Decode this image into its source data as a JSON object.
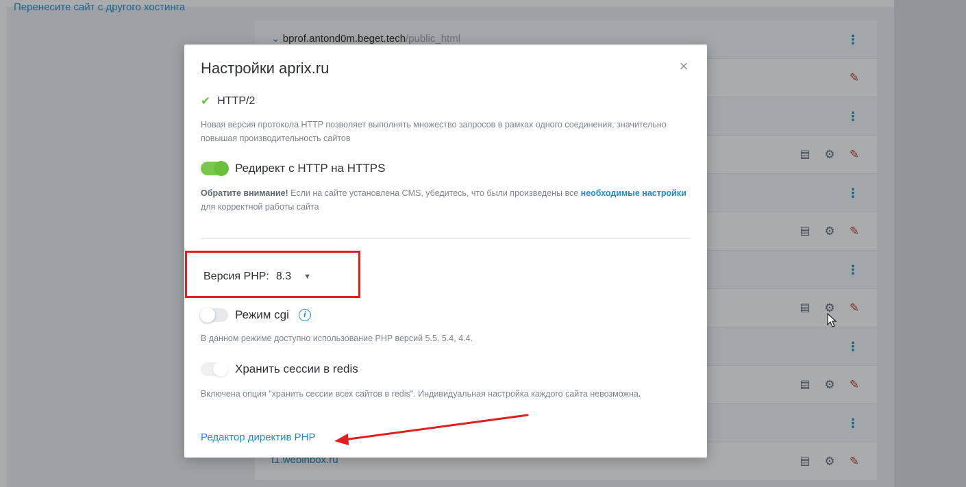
{
  "background": {
    "top_link": "Перенесите сайт с другого хостинга",
    "first_row": {
      "chevron": "⌄",
      "domain_strong": "bprof.antond0m.beget.tech",
      "domain_path": "/public_html"
    },
    "last_row_domain": "t1.webinbox.ru"
  },
  "modal": {
    "title": "Настройки aprix.ru",
    "close": "×",
    "http2": {
      "label": "HTTP/2",
      "description": "Новая версия протокола HTTP позволяет выполнять множество запросов в рамках одного соединения, значительно повышая производительность сайтов"
    },
    "redirect": {
      "label": "Редирект с HTTP на HTTPS",
      "enabled": true,
      "note_bold": "Обратите внимание!",
      "note_text": " Если на сайте установлена CMS, убедитесь, что были произведены все ",
      "note_link": "необходимые настройки",
      "note_tail": " для корректной работы сайта"
    },
    "php": {
      "label": "Версия PHP:",
      "value": "8.3"
    },
    "cgi": {
      "label": "Режим cgi",
      "info": "i",
      "enabled": false,
      "description": "В данном режиме доступно использование PHP версий 5.5, 5.4, 4.4."
    },
    "redis": {
      "label": "Хранить сессии в redis",
      "enabled": false,
      "disabled": true,
      "description": "Включена опция \"хранить сессии всех сайтов в redis\". Индивидуальная настройка каждого сайта невозможна."
    },
    "php_directives_link": "Редактор директив PHP"
  },
  "colors": {
    "accent": "#1a8cc9",
    "toggle_on": "#6cbf3c",
    "highlight_box": "#e02020",
    "arrow": "#e02020"
  }
}
